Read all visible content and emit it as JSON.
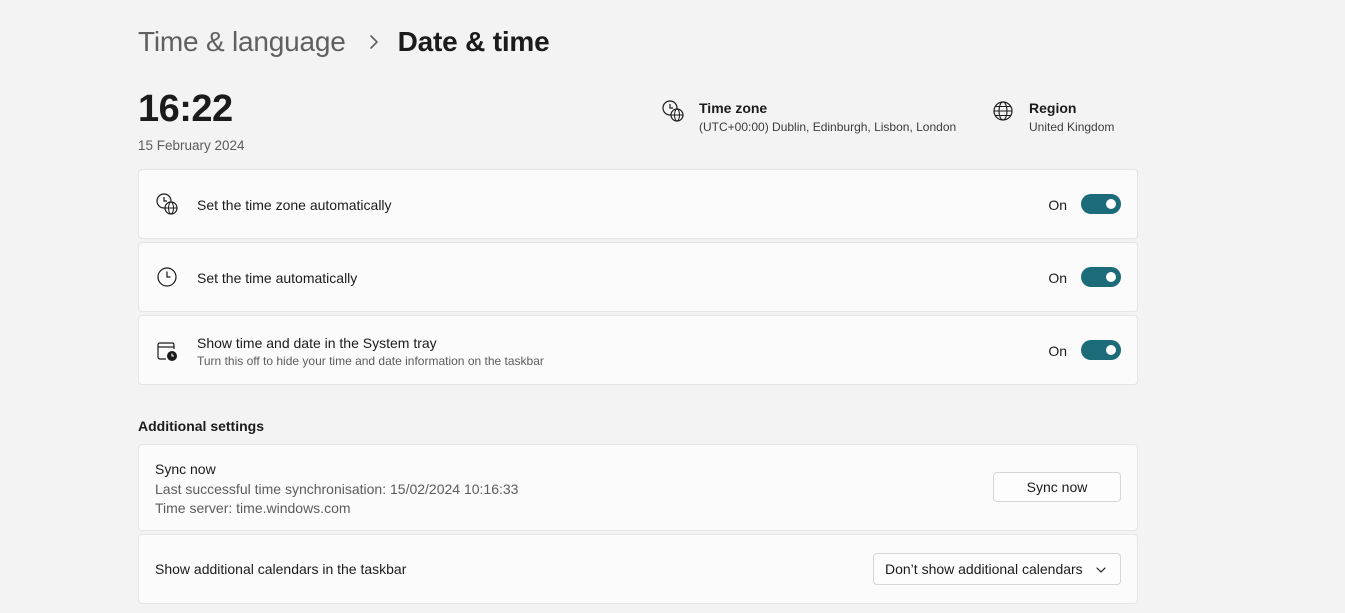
{
  "breadcrumb": {
    "parent": "Time & language",
    "current": "Date & time"
  },
  "clock": {
    "time": "16:22",
    "date": "15 February 2024"
  },
  "time_zone": {
    "title": "Time zone",
    "value": "(UTC+00:00) Dublin, Edinburgh, Lisbon, London",
    "icon": "time-zone-icon"
  },
  "region": {
    "title": "Region",
    "value": "United Kingdom",
    "icon": "globe-icon"
  },
  "settings": [
    {
      "label": "Set the time zone automatically",
      "state": "On",
      "icon": "time-zone-icon",
      "enabled": true
    },
    {
      "label": "Set the time automatically",
      "state": "On",
      "icon": "clock-icon",
      "enabled": true
    },
    {
      "label": "Show time and date in the System tray",
      "description": "Turn this off to hide your time and date information on the taskbar",
      "state": "On",
      "icon": "calendar-clock-icon",
      "enabled": true
    }
  ],
  "additional": {
    "title": "Additional settings",
    "sync": {
      "title": "Sync now",
      "last_sync": "Last successful time synchronisation: 15/02/2024 10:16:33",
      "server": "Time server: time.windows.com",
      "button": "Sync now"
    },
    "calendars": {
      "label": "Show additional calendars in the taskbar",
      "selected": "Don’t show additional calendars"
    }
  },
  "colors": {
    "accent": "#1c6b78",
    "background": "#f3f3f3",
    "card": "#fbfbfb"
  }
}
